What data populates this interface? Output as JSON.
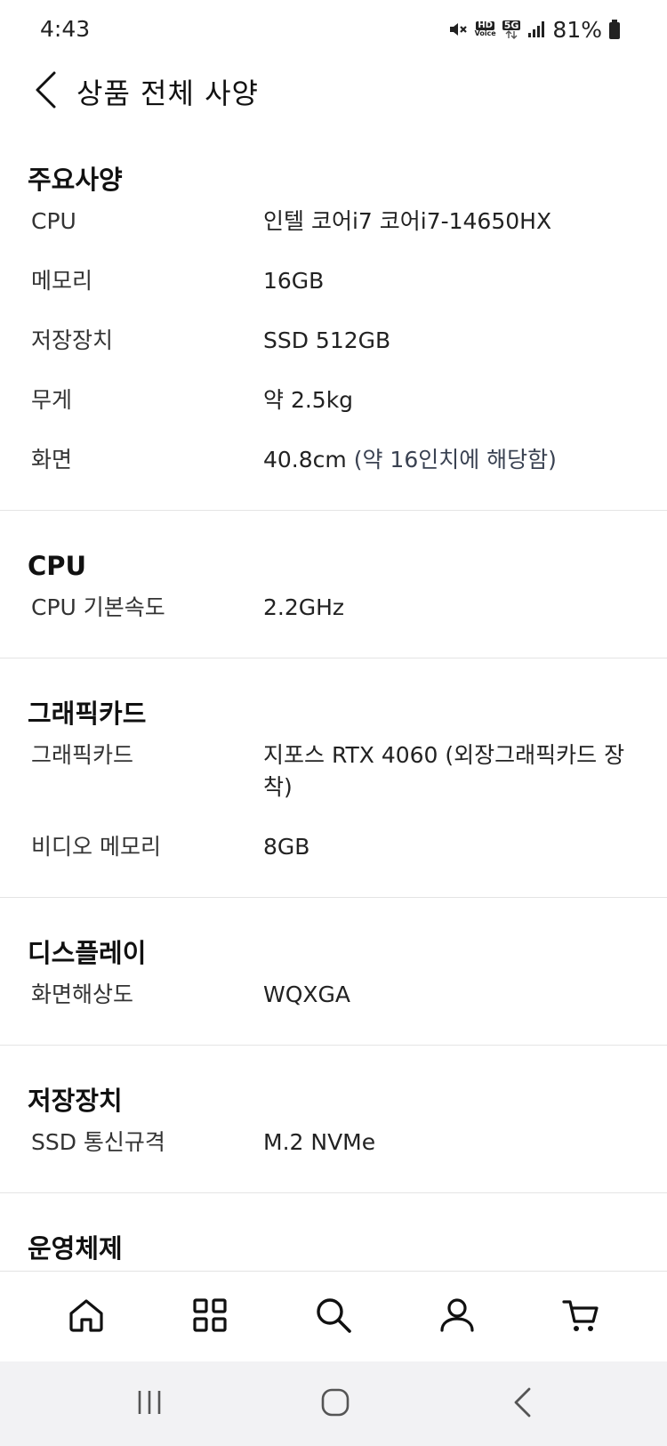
{
  "status_bar": {
    "time": "4:43",
    "battery": "81%",
    "icons": [
      "mute-icon",
      "hd-voice-icon",
      "5g-icon",
      "signal-icon",
      "battery-icon"
    ],
    "hd_label": "HD",
    "voice_label": "Voice",
    "fiveg_label": "5G"
  },
  "header": {
    "title": "상품 전체 사양",
    "back_icon": "chevron-left-icon"
  },
  "sections": [
    {
      "title": "주요사양",
      "rows": [
        {
          "label": "CPU",
          "value": "인텔 코어i7 코어i7-14650HX"
        },
        {
          "label": "메모리",
          "value": "16GB"
        },
        {
          "label": "저장장치",
          "value": "SSD 512GB"
        },
        {
          "label": "무게",
          "value": "약 2.5kg"
        },
        {
          "label": "화면",
          "value": "40.8cm",
          "note": "(약 16인치에 해당함)"
        }
      ]
    },
    {
      "title": "CPU",
      "rows": [
        {
          "label": "CPU 기본속도",
          "value": "2.2GHz"
        }
      ]
    },
    {
      "title": "그래픽카드",
      "rows": [
        {
          "label": "그래픽카드",
          "value": "지포스 RTX 4060 (외장그래픽카드 장착)"
        },
        {
          "label": "비디오 메모리",
          "value": "8GB"
        }
      ]
    },
    {
      "title": "디스플레이",
      "rows": [
        {
          "label": "화면해상도",
          "value": "WQXGA"
        }
      ]
    },
    {
      "title": "저장장치",
      "rows": [
        {
          "label": "SSD 통신규격",
          "value": "M.2 NVMe"
        }
      ]
    },
    {
      "title": "운영체제",
      "rows": []
    }
  ],
  "bottom_nav": {
    "items": [
      "home-icon",
      "category-grid-icon",
      "search-icon",
      "user-icon",
      "cart-icon"
    ]
  },
  "system_nav": {
    "items": [
      "recent-apps-icon",
      "home-circle-icon",
      "back-icon"
    ]
  },
  "colors": {
    "divider": "#e4e4e4",
    "system_nav_bg": "#f2f2f4",
    "note_text": "#3a4252"
  }
}
